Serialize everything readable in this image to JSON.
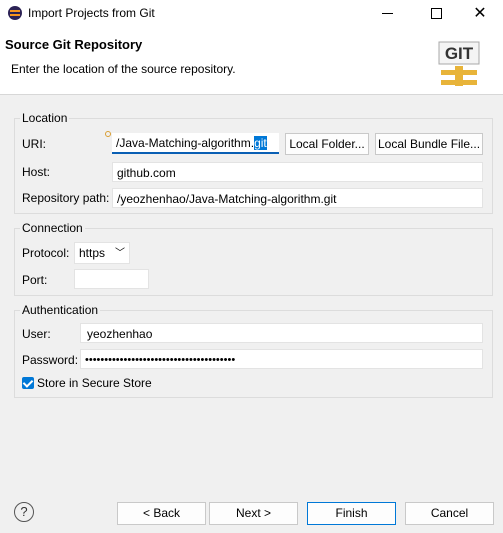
{
  "window": {
    "title": "Import Projects from Git"
  },
  "header": {
    "title": "Source Git Repository",
    "description": "Enter the location of the source repository.",
    "logo_text": "GIT"
  },
  "location": {
    "group_label": "Location",
    "uri_label": "URI:",
    "uri_value_visible": "/Java-Matching-algorithm.",
    "uri_value_selected": "git",
    "local_folder_button": "Local Folder...",
    "local_bundle_button": "Local Bundle File...",
    "host_label": "Host:",
    "host_value": "github.com",
    "repo_path_label": "Repository path:",
    "repo_path_value": "/yeozhenhao/Java-Matching-algorithm.git"
  },
  "connection": {
    "group_label": "Connection",
    "protocol_label": "Protocol:",
    "protocol_value": "https",
    "port_label": "Port:",
    "port_value": ""
  },
  "authentication": {
    "group_label": "Authentication",
    "user_label": "User:",
    "user_value": "yeozhenhao",
    "password_label": "Password:",
    "password_value": "•••••••••••••••••••••••••••••••••••••••",
    "store_label": "Store in Secure Store",
    "store_checked": true
  },
  "footer": {
    "help_symbol": "?",
    "back_label": "< Back",
    "next_label": "Next >",
    "finish_label": "Finish",
    "cancel_label": "Cancel"
  }
}
